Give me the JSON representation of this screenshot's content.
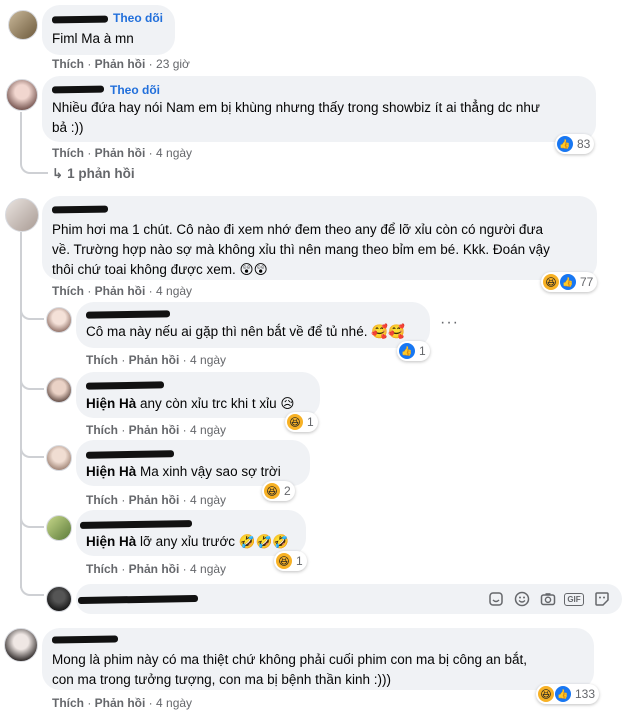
{
  "comments": [
    {
      "follow": "Theo dõi",
      "text": "Fiml Ma à mn",
      "like": "Thích",
      "reply": "Phản hồi",
      "time": "23 giờ"
    },
    {
      "follow": "Theo dõi",
      "text_line1": "Nhiều đứa hay nói Nam em bị khùng nhưng thấy trong showbiz ít ai thẳng dc như",
      "text_line2": "bả :))",
      "like": "Thích",
      "reply": "Phản hồi",
      "time": "4 ngày",
      "reaction_count": "83",
      "replies_link": "1 phản hồi"
    },
    {
      "text_line1": "Phim hơi ma 1 chút. Cô nào đi xem nhớ đem theo any để lỡ xỉu còn có người đưa",
      "text_line2": "về. Trường hợp nào sợ mà không xỉu thì nên mang theo bỉm em bé. Kkk. Đoán vậy",
      "text_line3": "thôi chứ toai không được xem. 😲😲",
      "like": "Thích",
      "reply": "Phản hồi",
      "time": "4 ngày",
      "reaction_count": "77",
      "replies": [
        {
          "text": "Cô ma này nếu ai gặp thì nên bắt về để tủ nhé. 🥰🥰",
          "like": "Thích",
          "reply": "Phản hồi",
          "time": "4 ngày",
          "reaction_count": "1"
        },
        {
          "mention": "Hiện Hà",
          "text": "any còn xỉu trc khi t xỉu 😥",
          "like": "Thích",
          "reply": "Phản hồi",
          "time": "4 ngày",
          "reaction_count": "1"
        },
        {
          "mention": "Hiện Hà",
          "text": "Ma xinh vậy sao sợ trời",
          "like": "Thích",
          "reply": "Phản hồi",
          "time": "4 ngày",
          "reaction_count": "2"
        },
        {
          "mention": "Hiện Hà",
          "text": "lỡ any xỉu trước 🤣🤣🤣",
          "like": "Thích",
          "reply": "Phản hồi",
          "time": "4 ngày",
          "reaction_count": "1"
        }
      ]
    },
    {
      "text_line1": "Mong là phim này có ma thiệt chứ không phải cuối phim con ma bị công an bắt,",
      "text_line2": "con ma trong tưởng tượng, con ma bị bệnh thần kinh :)))",
      "like": "Thích",
      "reply": "Phản hồi",
      "time": "4 ngày",
      "reaction_count": "133"
    }
  ],
  "composer": {
    "icons": [
      "sticker-icon",
      "emoji-icon",
      "camera-icon",
      "gif-icon",
      "sticker-face-icon"
    ],
    "gif_label": "GIF"
  },
  "colors": {
    "link": "#216fdb",
    "bubble": "#f0f2f5",
    "meta": "#65676b",
    "like": "#1877f2"
  }
}
